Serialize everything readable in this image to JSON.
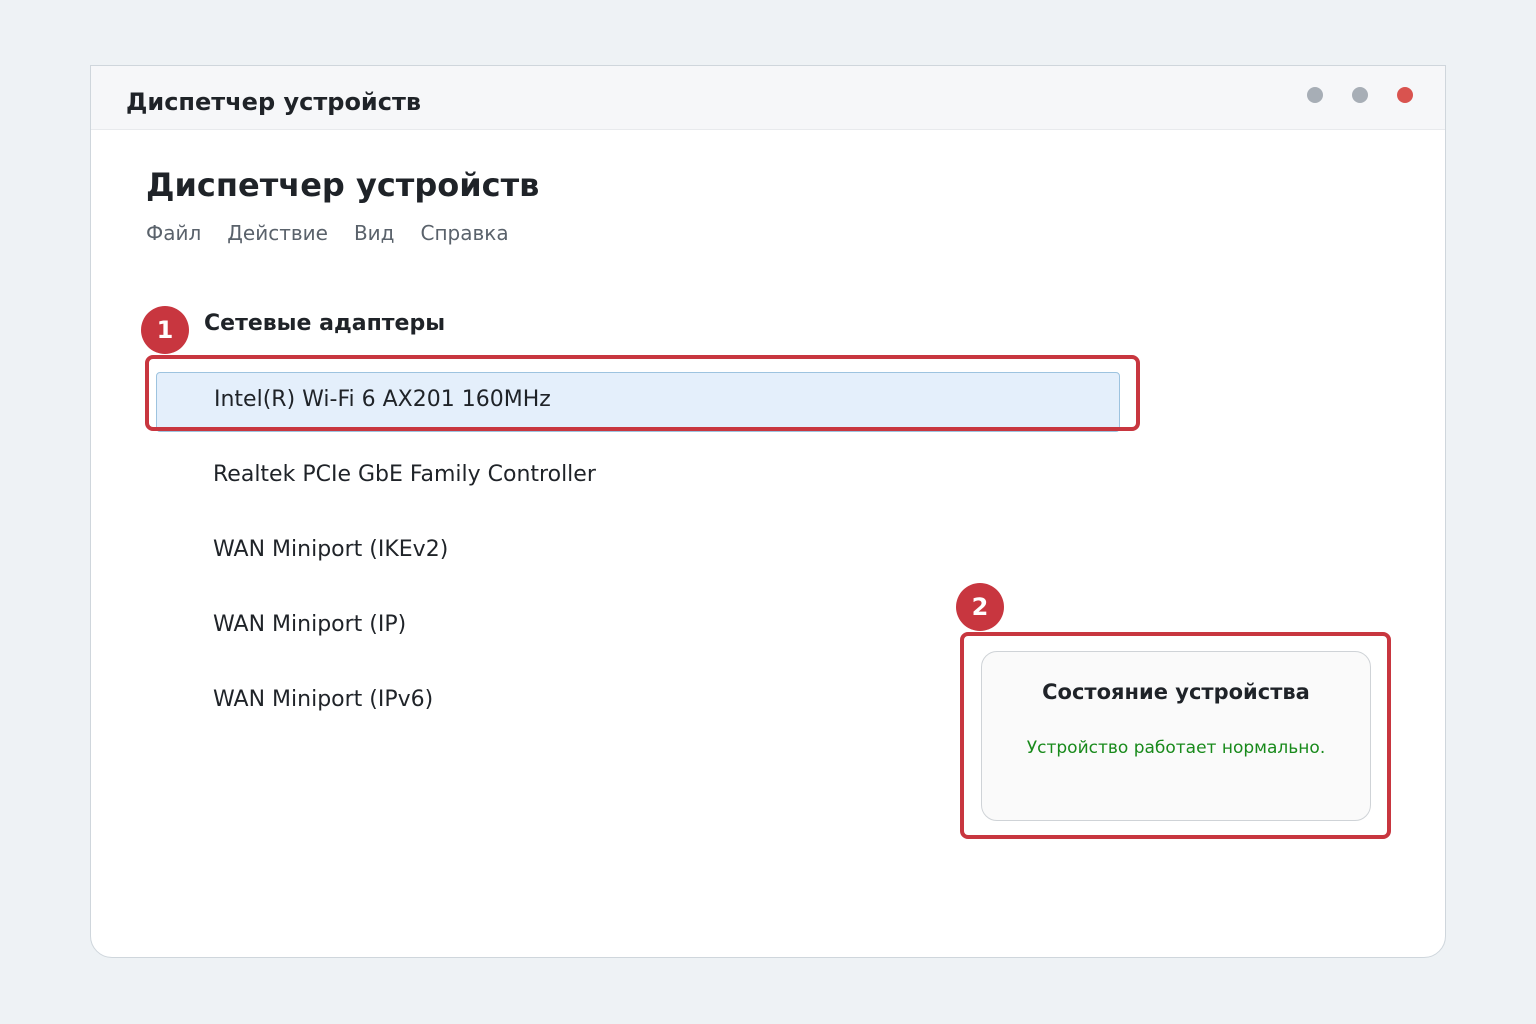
{
  "window": {
    "title": "Диспетчер устройств",
    "controls": [
      {
        "name": "minimize-dot",
        "color": "#a7aeb6"
      },
      {
        "name": "maximize-dot",
        "color": "#a7aeb6"
      },
      {
        "name": "close-dot",
        "color": "#d9534f"
      }
    ]
  },
  "page": {
    "title": "Диспетчер устройств"
  },
  "menu": [
    {
      "label": "Файл"
    },
    {
      "label": "Действие"
    },
    {
      "label": "Вид"
    },
    {
      "label": "Справка"
    }
  ],
  "category": {
    "label": "Сетевые адаптеры"
  },
  "devices": [
    {
      "label": "Intel(R) Wi-Fi 6 AX201 160MHz",
      "selected": true
    },
    {
      "label": "Realtek PCIe GbE Family Controller",
      "selected": false
    },
    {
      "label": "WAN Miniport (IKEv2)",
      "selected": false
    },
    {
      "label": "WAN Miniport (IP)",
      "selected": false
    },
    {
      "label": "WAN Miniport (IPv6)",
      "selected": false
    }
  ],
  "status_panel": {
    "title": "Состояние устройства",
    "text": "Устройство работает нормально."
  },
  "annotations": [
    {
      "number": "1"
    },
    {
      "number": "2"
    }
  ],
  "colors": {
    "accent": "#c8363f",
    "status_ok": "#188a1b",
    "selection": "#e4effb"
  }
}
